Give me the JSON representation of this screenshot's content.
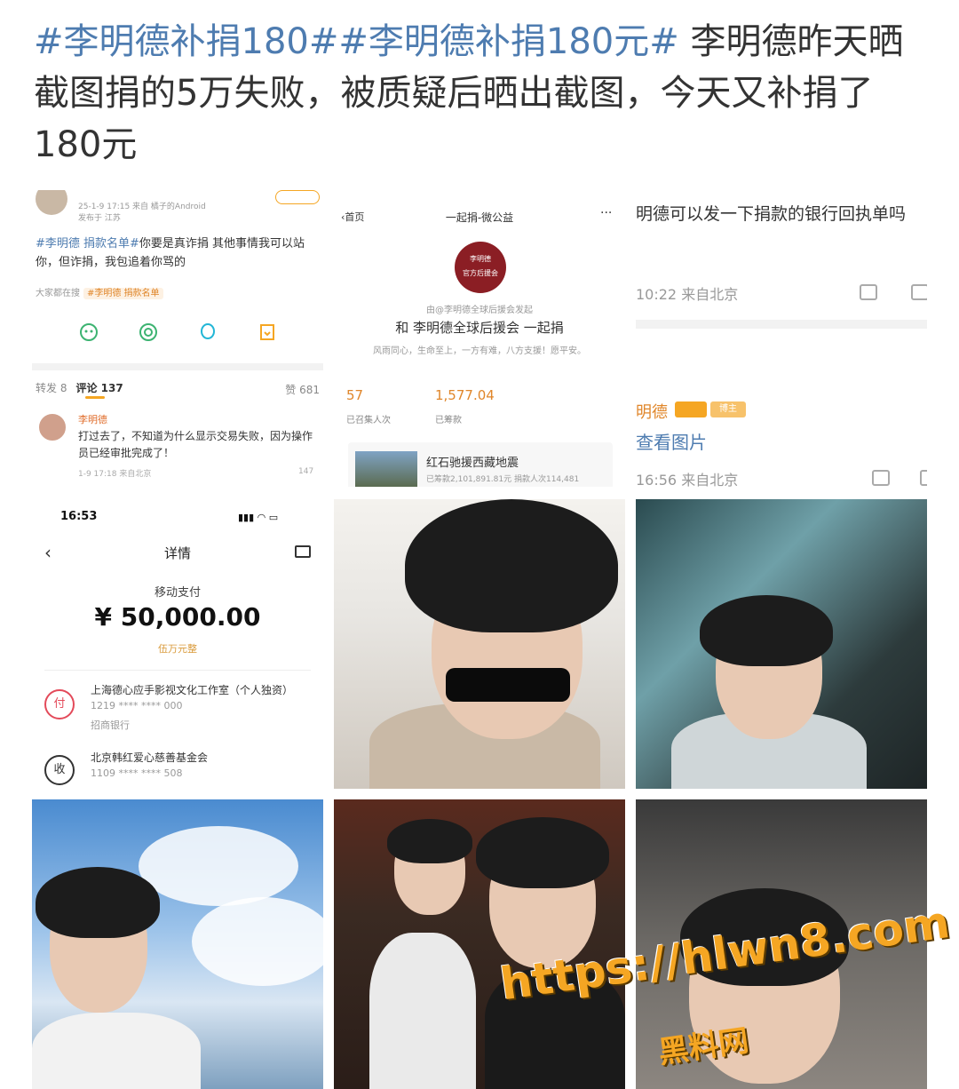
{
  "post": {
    "tag1": "#李明德补捐180#",
    "tag2": "#李明德补捐180元#",
    "text": " 李明德昨天晒截图捐的5万失败，被质疑后晒出截图，今天又补捐了180元"
  },
  "cell1": {
    "meta_time": "25-1-9 17:15 来自 橘子的Android",
    "meta_loc": "发布于 江苏",
    "tag": "#李明德 捐款名单#",
    "body": "你要是真诈捐 其他事情我可以站你，但诈捐，我包追着你骂的",
    "hot_label": "大家都在搜",
    "hot_chip": "#李明德 捐款名单",
    "tab_repost": "转发 8",
    "tab_comment": "评论 137",
    "likes": "赞 681",
    "comment_user": "李明德",
    "comment_text": "打过去了，不知道为什么显示交易失败，因为操作员已经审批完成了！",
    "comment_meta": "1-9 17:18 来自北京",
    "comment_likes": "147",
    "share_icons": [
      "wechat-icon",
      "moments-icon",
      "qq-icon",
      "save-icon"
    ]
  },
  "cell2": {
    "back": "首页",
    "title": "一起捐-微公益",
    "more": "···",
    "logo_line1": "李明德",
    "logo_line2": "官方后援会",
    "by": "由@李明德全球后援会发起",
    "campaign": "和 李明德全球后援会 一起捐",
    "slogan": "风雨同心，生命至上，一方有难，八方支援！愿平安。",
    "people_count": "57",
    "people_label": "已召集人次",
    "amount": "1,577.04",
    "amount_label": "已筹款",
    "card_title": "红石驰援西藏地震",
    "card_stats": "已筹款2,101,891.81元  捐款人次114,481"
  },
  "cell3": {
    "line1": "明德可以发一下捐款的银行回执单吗",
    "time1": "10:22 来自北京",
    "uname": "明德",
    "badge": "博主",
    "view": "查看图片",
    "time2": "16:56 来自北京"
  },
  "cell4": {
    "status_time": "16:53",
    "status_icons": "▮▮▮ ◠ ▭",
    "title": "详情",
    "method": "移动支付",
    "amount": "¥  50,000.00",
    "words": "伍万元整",
    "pay_icon": "付",
    "payer_name": "上海德心应手影视文化工作室（个人独资）",
    "payer_acct": "1219 **** **** 000",
    "payer_bank": "招商银行",
    "rcv_icon": "收",
    "receiver_name": "北京韩红爱心慈善基金会",
    "receiver_acct": "1109 **** **** 508"
  },
  "watermark": {
    "url": "https://hlwn8.com",
    "name": "黑料网"
  },
  "colors": {
    "tag": "#4e7cb0",
    "accent": "#f5a623",
    "donate": "#e0862a"
  }
}
